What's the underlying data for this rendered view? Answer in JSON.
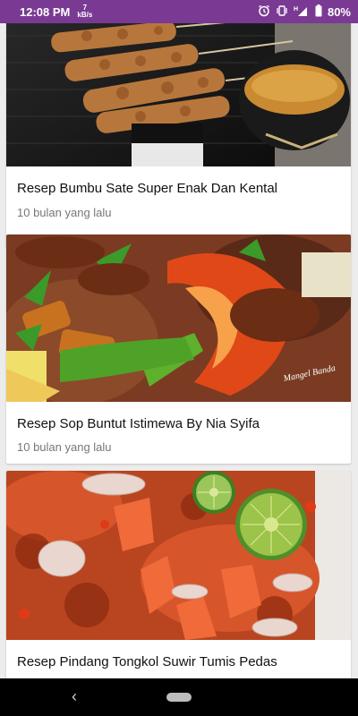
{
  "status_bar": {
    "time": "12:08 PM",
    "speed_value": "7",
    "speed_unit": "kB/s",
    "network": "H",
    "battery": "80%",
    "icons": [
      "alarm-icon",
      "vibrate-icon",
      "signal-icon",
      "battery-icon"
    ]
  },
  "recipes": [
    {
      "title": "Resep Bumbu Sate Super Enak Dan Kental",
      "time_ago": "10 bulan yang lalu",
      "image": "sate-image"
    },
    {
      "title": "Resep Sop Buntut Istimewa By Nia Syifa",
      "time_ago": "10 bulan yang lalu",
      "image": "sop-buntut-image"
    },
    {
      "title": "Resep Pindang Tongkol Suwir Tumis Pedas",
      "time_ago": "",
      "image": "pindang-tongkol-image"
    }
  ],
  "image_watermark": "Mangel Banda",
  "navigation_bar": {
    "back": "‹"
  },
  "colors": {
    "status_bar": "#7a3a93",
    "background": "#ececec",
    "card": "#ffffff"
  }
}
